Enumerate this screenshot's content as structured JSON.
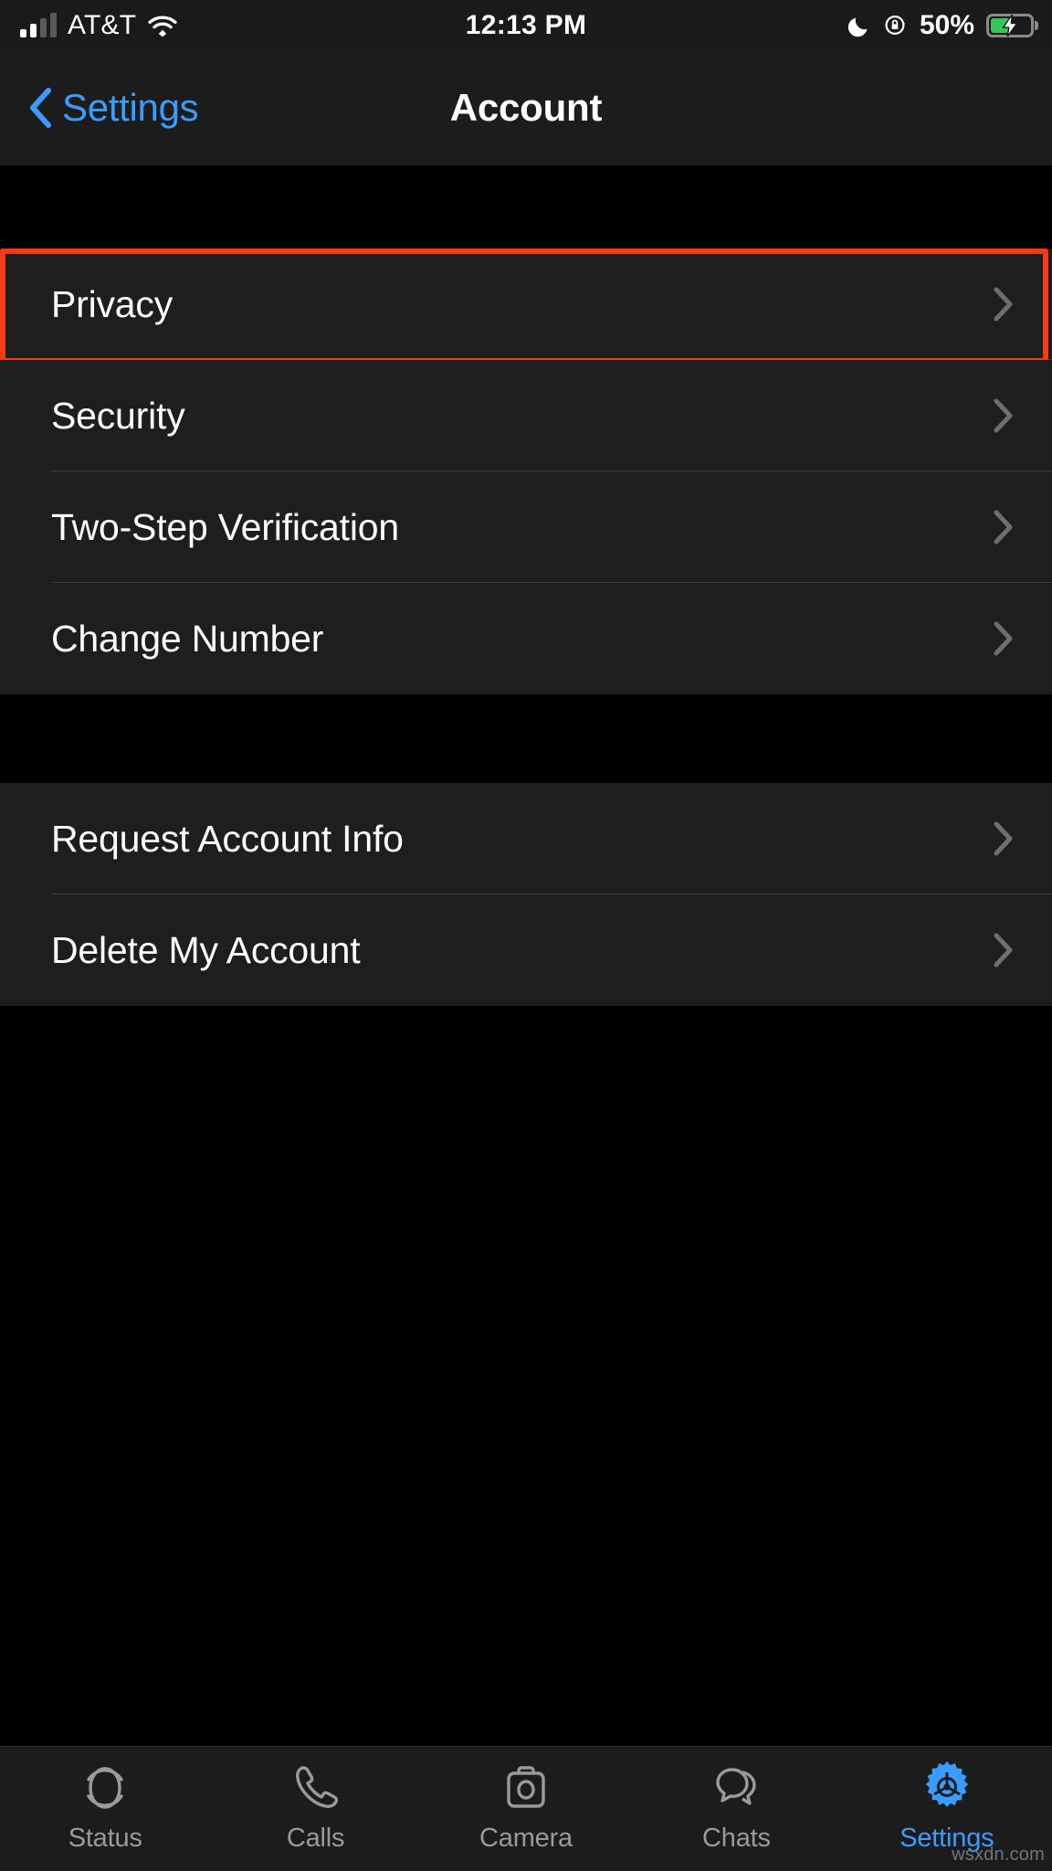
{
  "status_bar": {
    "carrier": "AT&T",
    "time": "12:13 PM",
    "battery_percent": "50%",
    "signal_bars_filled": 2,
    "signal_bars_total": 4,
    "icons": [
      "cellular-signal-icon",
      "wifi-icon",
      "moon-icon",
      "rotation-lock-icon",
      "battery-charging-icon"
    ]
  },
  "nav_bar": {
    "back_label": "Settings",
    "title": "Account"
  },
  "sections": [
    {
      "rows": [
        {
          "label": "Privacy",
          "highlighted": true
        },
        {
          "label": "Security",
          "highlighted": false
        },
        {
          "label": "Two-Step Verification",
          "highlighted": false
        },
        {
          "label": "Change Number",
          "highlighted": false
        }
      ]
    },
    {
      "rows": [
        {
          "label": "Request Account Info",
          "highlighted": false
        },
        {
          "label": "Delete My Account",
          "highlighted": false
        }
      ]
    }
  ],
  "tab_bar": {
    "tabs": [
      {
        "label": "Status",
        "icon": "status-ring-icon",
        "active": false
      },
      {
        "label": "Calls",
        "icon": "phone-icon",
        "active": false
      },
      {
        "label": "Camera",
        "icon": "camera-icon",
        "active": false
      },
      {
        "label": "Chats",
        "icon": "chat-bubbles-icon",
        "active": false
      },
      {
        "label": "Settings",
        "icon": "gear-icon",
        "active": true
      }
    ]
  },
  "watermark": "wsxdn.com",
  "colors": {
    "accent_blue": "#3b9cff",
    "highlight_red": "#f43a18",
    "row_bg": "#1e1e1e",
    "page_bg": "#000000",
    "battery_green": "#35c759"
  }
}
